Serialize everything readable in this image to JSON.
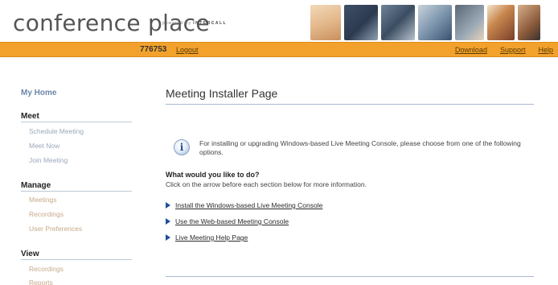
{
  "header": {
    "logo": "conference place",
    "tagline_prefix": "powered by",
    "tagline_brand": "INTERCALL"
  },
  "navbar": {
    "account_id": "776753",
    "logout": "Logout",
    "links": [
      "Download",
      "Support",
      "Help"
    ]
  },
  "sidebar": {
    "my_home": "My Home",
    "sections": [
      {
        "title": "Meet",
        "items": [
          "Schedule Meeting",
          "Meet Now",
          "Join Meeting"
        ]
      },
      {
        "title": "Manage",
        "items": [
          "Meetings",
          "Recordings",
          "User Preferences"
        ]
      },
      {
        "title": "View",
        "items": [
          "Recordings",
          "Reports"
        ]
      }
    ]
  },
  "main": {
    "title": "Meeting Installer Page",
    "info": "For installing or upgrading Windows-based Live Meeting Console, please choose from one of the following options.",
    "question": "What would you like to do?",
    "instruction": "Click on the arrow before each section below for more information.",
    "options": [
      "Install the Windows-based Live Meeting Console",
      "Use the Web-based Meeting Console",
      "Live Meeting Help Page"
    ]
  },
  "colors": {
    "nav_orange": "#f2a22c",
    "rule_blue": "#a9b9d0",
    "arrow_blue": "#1f4d9e"
  }
}
